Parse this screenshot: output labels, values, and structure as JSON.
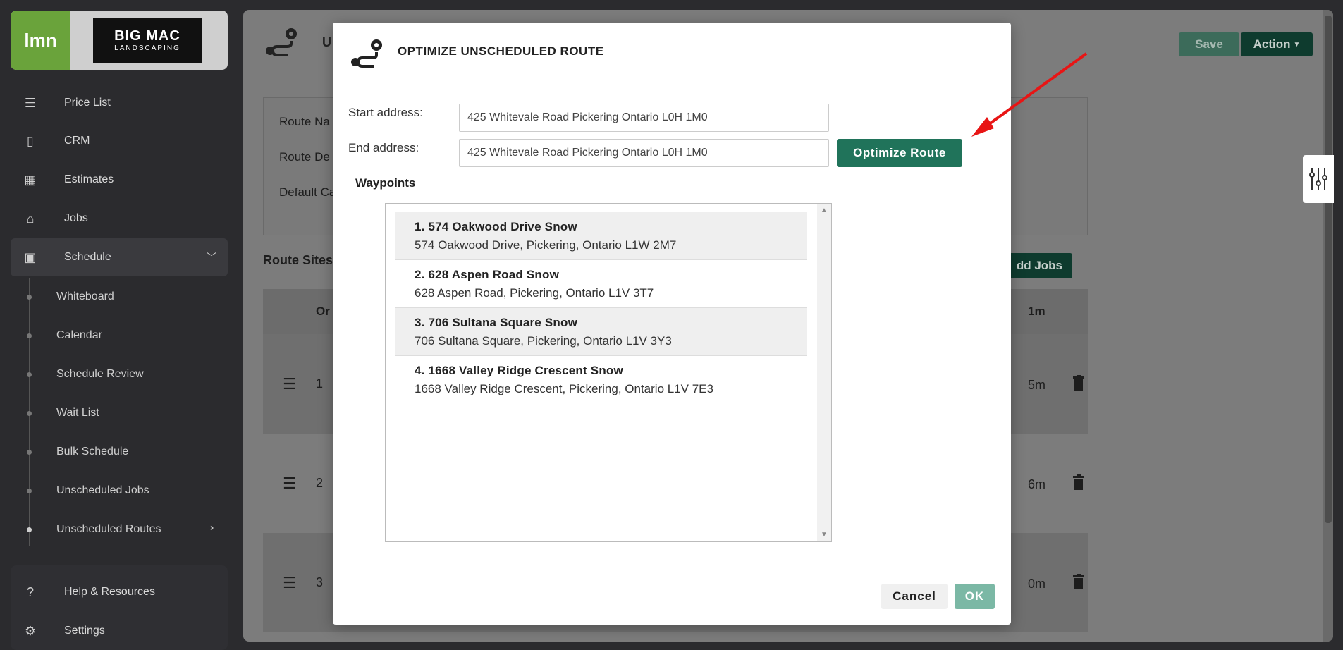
{
  "sidebar": {
    "brand_lmn": "lmn",
    "brand_company_line1": "BIG MAC",
    "brand_company_line2": "LANDSCAPING",
    "items": [
      {
        "label": "Price List",
        "icon": "list-icon"
      },
      {
        "label": "CRM",
        "icon": "contact-card-icon"
      },
      {
        "label": "Estimates",
        "icon": "calculator-icon"
      },
      {
        "label": "Jobs",
        "icon": "warehouse-icon"
      },
      {
        "label": "Schedule",
        "icon": "calendar-icon"
      }
    ],
    "sub_items": [
      {
        "label": "Whiteboard"
      },
      {
        "label": "Calendar"
      },
      {
        "label": "Schedule Review"
      },
      {
        "label": "Wait List"
      },
      {
        "label": "Bulk Schedule"
      },
      {
        "label": "Unscheduled Jobs"
      },
      {
        "label": "Unscheduled Routes"
      }
    ],
    "bottom_items": [
      {
        "label": "Help & Resources",
        "icon": "help-icon"
      },
      {
        "label": "Settings",
        "icon": "gear-icon"
      }
    ]
  },
  "page": {
    "title_initial": "U",
    "save_label": "Save",
    "action_label": "Action",
    "route_labels": [
      "Route Na",
      "Route De",
      "Default Ca"
    ],
    "route_sites_title": "Route Sites",
    "add_jobs_label": "dd Jobs",
    "table": {
      "col_order": "Or",
      "col_time": "1m",
      "rows": [
        {
          "num": "1",
          "duration": "5m"
        },
        {
          "num": "2",
          "duration": "6m"
        },
        {
          "num": "3",
          "duration": "0m"
        }
      ]
    }
  },
  "modal": {
    "title": "OPTIMIZE UNSCHEDULED ROUTE",
    "start_label": "Start address:",
    "start_value": "425 Whitevale Road Pickering Ontario L0H 1M0",
    "end_label": "End address:",
    "end_value": "425 Whitevale Road Pickering Ontario L0H 1M0",
    "optimize_label": "Optimize Route",
    "waypoints_label": "Waypoints",
    "waypoints": [
      {
        "title": "1. 574 Oakwood Drive Snow",
        "address": "574 Oakwood Drive, Pickering, Ontario L1W 2M7"
      },
      {
        "title": "2. 628 Aspen Road Snow",
        "address": "628 Aspen Road, Pickering, Ontario L1V 3T7"
      },
      {
        "title": "3. 706 Sultana Square Snow",
        "address": "706 Sultana Square, Pickering, Ontario L1V 3Y3"
      },
      {
        "title": "4. 1668 Valley Ridge Crescent Snow",
        "address": "1668 Valley Ridge Crescent, Pickering, Ontario L1V 7E3"
      }
    ],
    "cancel_label": "Cancel",
    "ok_label": "OK"
  },
  "colors": {
    "primary_green": "#20735a",
    "ok_disabled": "#7bb8a5",
    "annotation_arrow": "#e81515"
  }
}
